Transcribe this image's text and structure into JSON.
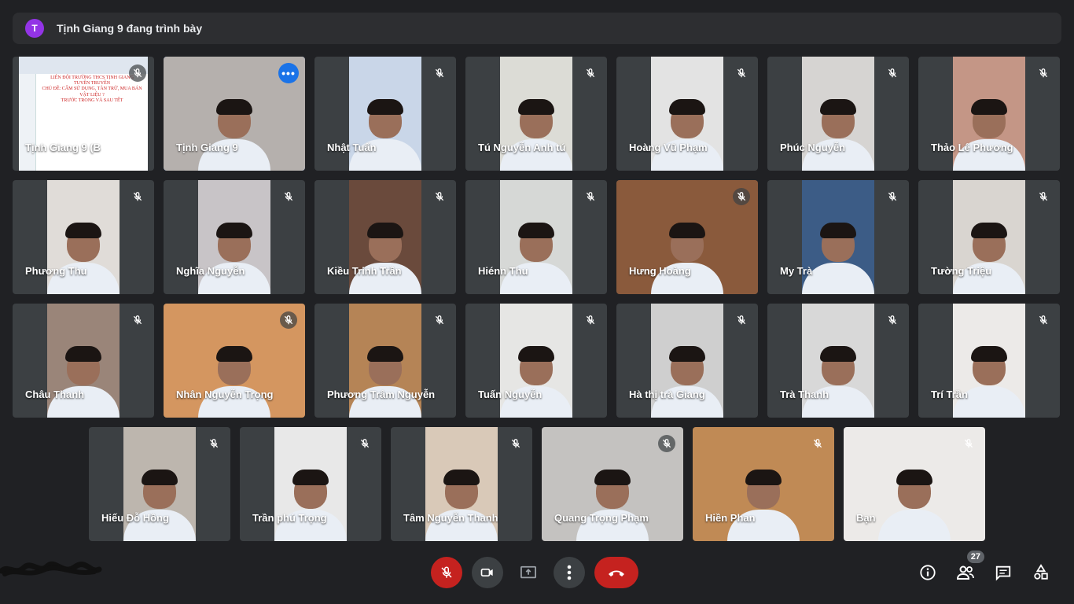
{
  "banner": {
    "avatar_letter": "T",
    "text": "Tịnh Giang 9 đang trình bày"
  },
  "participants": [
    {
      "name": "Tịnh Giang 9 (B",
      "bg": "#ffffff"
    },
    {
      "name": "Tịnh Giang 9",
      "bg": "#b5b0ad"
    },
    {
      "name": "Nhật Tuấn",
      "bg": "#c9d6e8"
    },
    {
      "name": "Tú Nguyễn Anh tú",
      "bg": "#dcdcd6"
    },
    {
      "name": "Hoàng Vũ Phạm",
      "bg": "#e3e3e3"
    },
    {
      "name": "Phúc Nguyễn",
      "bg": "#d6d4d2"
    },
    {
      "name": "Thảo Lê Phương",
      "bg": "#c49686"
    },
    {
      "name": "Phương Thu",
      "bg": "#e0dcd8"
    },
    {
      "name": "Nghĩa Nguyễn",
      "bg": "#c8c4c7"
    },
    {
      "name": "Kiều Trinh Trần",
      "bg": "#6a4a3c"
    },
    {
      "name": "Hiénn Thu",
      "bg": "#d6d8d6"
    },
    {
      "name": "Hưng Hoàng",
      "bg": "#8a5a3c"
    },
    {
      "name": "My Trà",
      "bg": "#3c5c86"
    },
    {
      "name": "Tường Triệu",
      "bg": "#d9d5d0"
    },
    {
      "name": "Châu Thanh",
      "bg": "#9a8579"
    },
    {
      "name": "Nhân Nguyễn Trọng",
      "bg": "#d49660"
    },
    {
      "name": "Phương Trâm Nguyễn",
      "bg": "#b58456"
    },
    {
      "name": "Tuấn Nguyễn",
      "bg": "#e6e6e4"
    },
    {
      "name": "Hà thị trà Giang",
      "bg": "#cfcfcf"
    },
    {
      "name": "Trà Thanh",
      "bg": "#d8d8d8"
    },
    {
      "name": "Trí Trần",
      "bg": "#eceae8"
    },
    {
      "name": "Hiếu Đỗ Hồng",
      "bg": "#bdb6ae"
    },
    {
      "name": "Trần phú Trọng",
      "bg": "#e8e8e8"
    },
    {
      "name": "Tâm Nguyễn Thanh",
      "bg": "#d9c9b8"
    },
    {
      "name": "Quang Trọng Phạm",
      "bg": "#c4c2c0"
    },
    {
      "name": "Hiền Phan",
      "bg": "#c08a55"
    },
    {
      "name": "Bạn",
      "bg": "#eceae8"
    }
  ],
  "slide": {
    "line1": "LIÊN ĐỘI TRƯỜNG THCS TỊNH GIANG",
    "line2": "TUYÊN TRUYỀN",
    "line3": "CHỦ ĐỀ: CẤM SỬ DỤNG, TÀN TRỮ, MUA BÁN VẬT LIỆU ?",
    "line4": "TRƯỚC TRONG VÀ SAU TẾT"
  },
  "controls": {
    "mic": "mic-off-icon",
    "camera": "camera-icon",
    "present": "present-icon",
    "more": "more-icon",
    "end": "end-call-icon"
  },
  "side": {
    "people_count": "27"
  },
  "colors": {
    "accent": "#1a73e8",
    "danger": "#c5221f",
    "tile": "#3c4043",
    "background": "#202124",
    "banner_avatar": "#9334e6"
  }
}
